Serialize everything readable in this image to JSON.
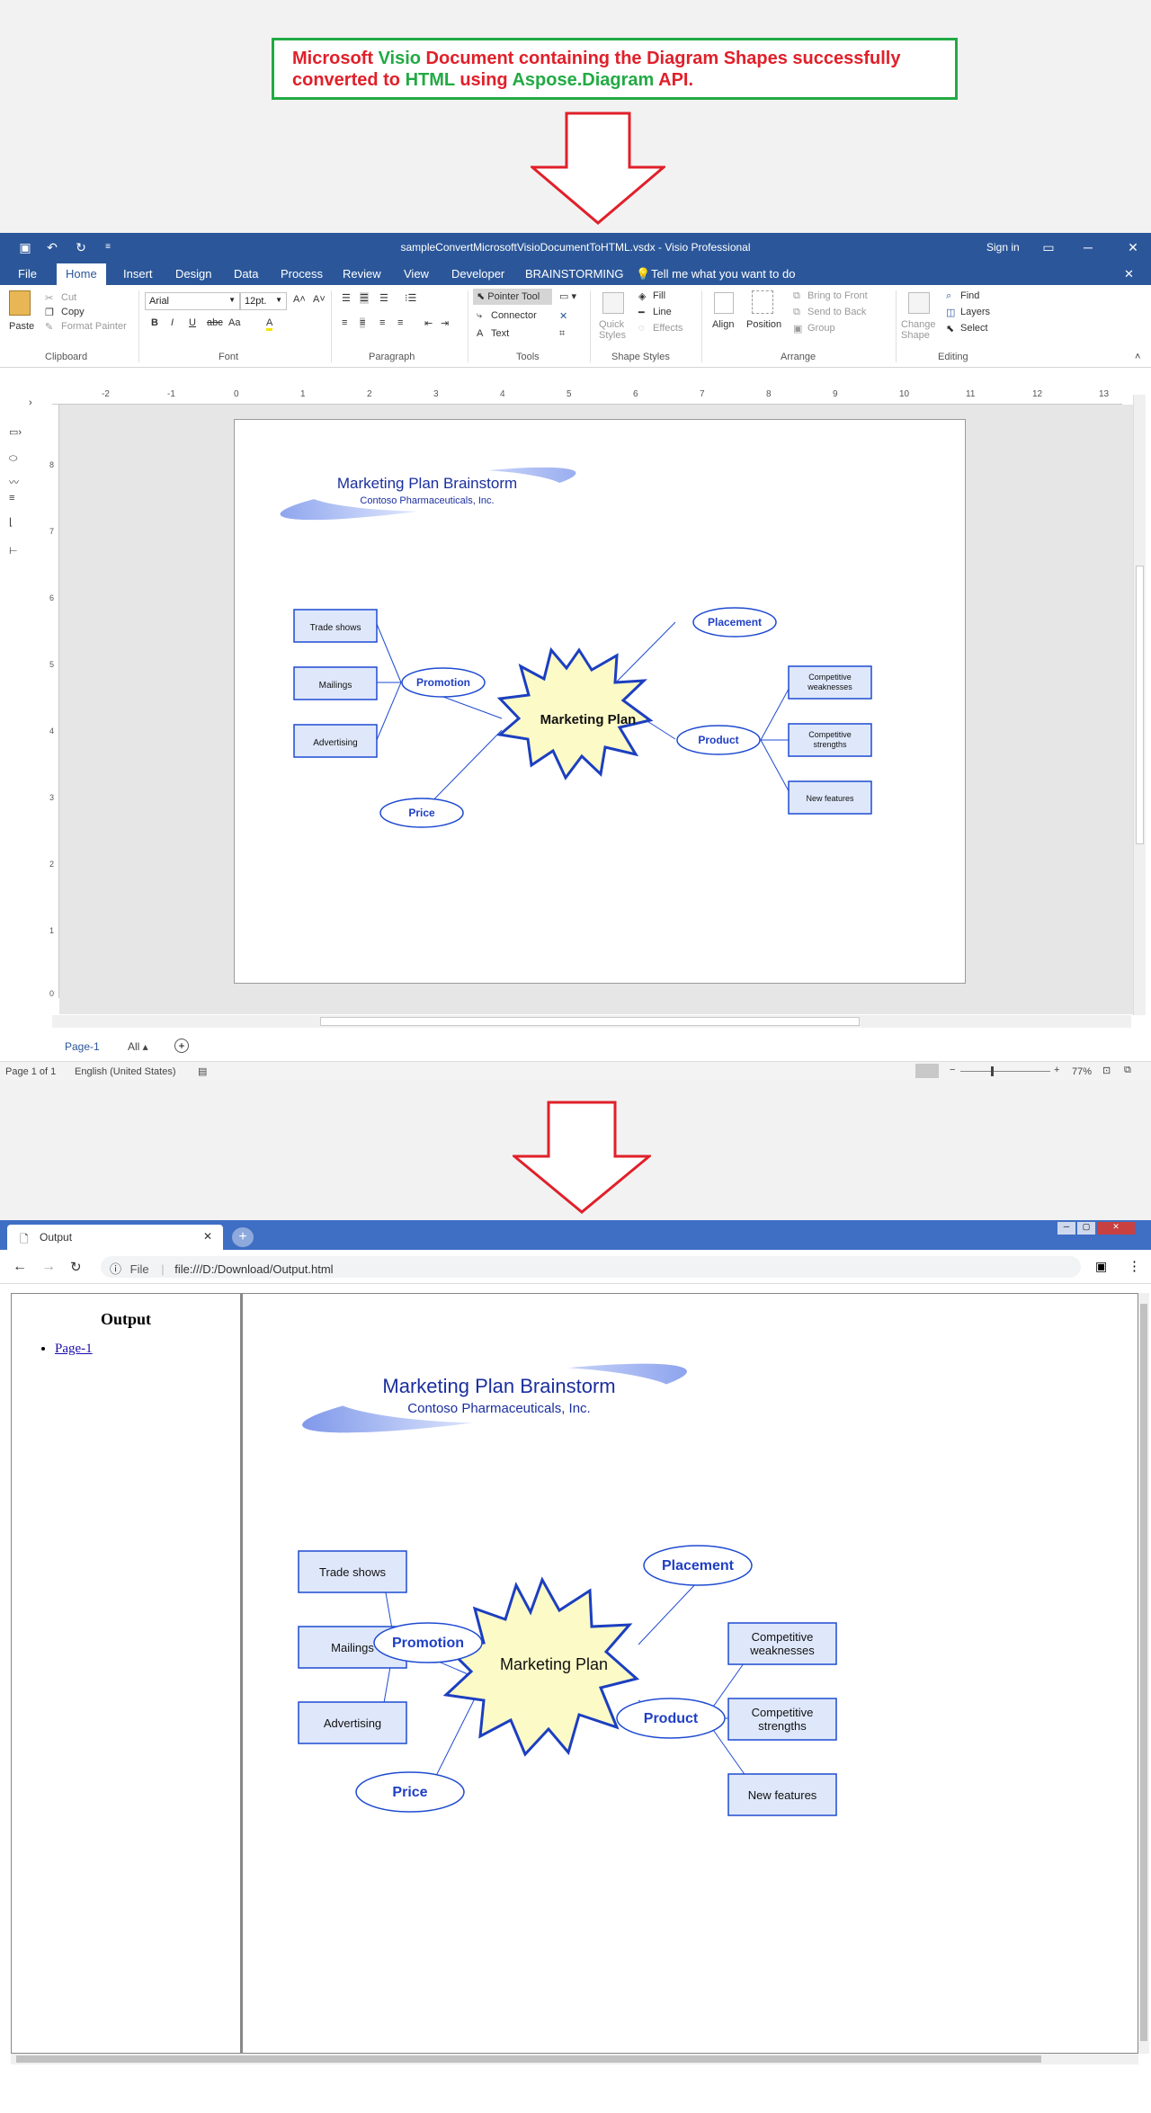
{
  "caption": {
    "part1": "Microsoft ",
    "part2": "Visio",
    "part3": " Document containing the Diagram Shapes successfully",
    "part4": "converted to ",
    "part5": "HTML",
    "part6": " using ",
    "part7": "Aspose.Diagram",
    "part8": " API."
  },
  "visio": {
    "window_title": "sampleConvertMicrosoftVisioDocumentToHTML.vsdx - Visio Professional",
    "sign_in": "Sign in",
    "menu": [
      "File",
      "Home",
      "Insert",
      "Design",
      "Data",
      "Process",
      "Review",
      "View",
      "Developer",
      "BRAINSTORMING"
    ],
    "tell_me": "Tell me what you want to do",
    "ribbon": {
      "paste": "Paste",
      "cut": "Cut",
      "copy": "Copy",
      "format_painter": "Format Painter",
      "clipboard": "Clipboard",
      "font_name": "Arial",
      "font_size": "12pt.",
      "font": "Font",
      "paragraph": "Paragraph",
      "pointer_tool": "Pointer Tool",
      "connector": "Connector",
      "text": "Text",
      "tools": "Tools",
      "quick_styles": "Quick Styles",
      "fill": "Fill",
      "line": "Line",
      "effects": "Effects",
      "shape_styles": "Shape Styles",
      "align": "Align",
      "position": "Position",
      "bring_to_front": "Bring to Front",
      "send_to_back": "Send to Back",
      "group": "Group",
      "arrange": "Arrange",
      "change_shape": "Change Shape",
      "find": "Find",
      "layers": "Layers",
      "select": "Select",
      "editing": "Editing"
    },
    "ruler_top": [
      "-2",
      "-1",
      "0",
      "1",
      "2",
      "3",
      "4",
      "5",
      "6",
      "7",
      "8",
      "9",
      "10",
      "11",
      "12",
      "13"
    ],
    "ruler_left": [
      "8",
      "7",
      "6",
      "5",
      "4",
      "3",
      "2",
      "1",
      "0"
    ],
    "page_tab": "Page-1",
    "all_tab": "All",
    "status_page": "Page 1 of 1",
    "status_lang": "English (United States)",
    "zoom": "77%"
  },
  "diagram": {
    "title": "Marketing Plan Brainstorm",
    "subtitle": "Contoso Pharmaceuticals, Inc.",
    "center": "Marketing Plan",
    "promotion": "Promotion",
    "price": "Price",
    "placement": "Placement",
    "product": "Product",
    "trade_shows": "Trade shows",
    "mailings": "Mailings",
    "advertising": "Advertising",
    "competitive_weaknesses_1": "Competitive",
    "competitive_weaknesses_2": "weaknesses",
    "competitive_strengths_1": "Competitive",
    "competitive_strengths_2": "strengths",
    "new_features": "New features"
  },
  "browser": {
    "tab_title": "Output",
    "file_label": "File",
    "url": "file:///D:/Download/Output.html",
    "sidebar_title": "Output",
    "sidebar_link": "Page-1"
  },
  "colors": {
    "red": "#e0202a",
    "green": "#22aa44",
    "visio_blue": "#2b579a",
    "diagram_blue": "#1f4bd1"
  }
}
